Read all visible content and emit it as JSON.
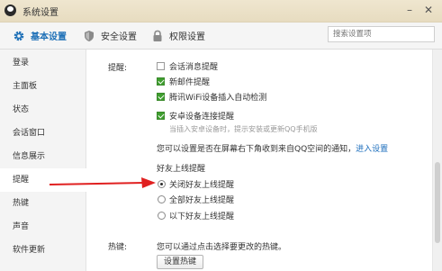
{
  "window": {
    "title": "系统设置",
    "minimize_glyph": "–",
    "close_glyph": "✕"
  },
  "tabs": [
    {
      "label": "基本设置",
      "icon": "gear-icon",
      "active": true
    },
    {
      "label": "安全设置",
      "icon": "shield-icon",
      "active": false
    },
    {
      "label": "权限设置",
      "icon": "lock-icon",
      "active": false
    }
  ],
  "search": {
    "placeholder": "搜索设置项"
  },
  "sidebar": {
    "items": [
      {
        "label": "登录"
      },
      {
        "label": "主面板"
      },
      {
        "label": "状态"
      },
      {
        "label": "会话窗口"
      },
      {
        "label": "信息展示"
      },
      {
        "label": "提醒",
        "active": true
      },
      {
        "label": "热键"
      },
      {
        "label": "声音"
      },
      {
        "label": "软件更新"
      }
    ]
  },
  "reminders": {
    "label": "提醒:",
    "options": [
      {
        "label": "会话消息提醒",
        "checked": false
      },
      {
        "label": "新邮件提醒",
        "checked": true
      },
      {
        "label": "腾讯WiFi设备插入自动检测",
        "checked": true
      },
      {
        "label": "安卓设备连接提醒",
        "checked": true
      }
    ],
    "android_hint": "当插入安卓设备时，提示安装或更新QQ手机版",
    "qzone_notice": "您可以设置是否在屏幕右下角收到来自QQ空间的通知，",
    "qzone_link": "进入设置",
    "friend_online_title": "好友上线提醒",
    "friend_online_options": [
      {
        "label": "关闭好友上线提醒",
        "selected": true
      },
      {
        "label": "全部好友上线提醒",
        "selected": false
      },
      {
        "label": "以下好友上线提醒",
        "selected": false
      }
    ]
  },
  "hotkeys": {
    "label": "热键:",
    "description": "您可以通过点击选择要更改的热键。",
    "button_label": "设置热键"
  },
  "colors": {
    "accent": "#1e70b7",
    "checkbox_green": "#3f9e2f",
    "annotation_arrow": "#e02020",
    "titlebar": "#ece3c9"
  }
}
